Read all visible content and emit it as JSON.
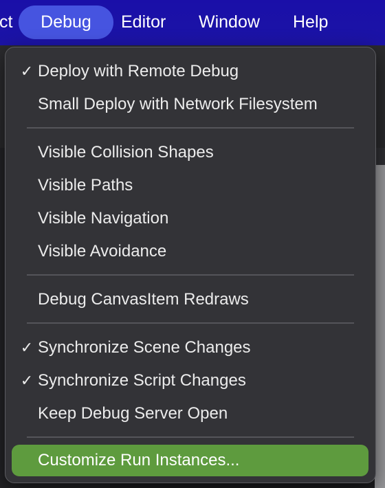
{
  "menubar": {
    "items": [
      {
        "label": "ct"
      },
      {
        "label": "Debug"
      },
      {
        "label": "Editor"
      },
      {
        "label": "Window"
      },
      {
        "label": "Help"
      }
    ]
  },
  "menu": {
    "items": [
      {
        "label": "Deploy with Remote Debug",
        "check": "✓"
      },
      {
        "label": "Small Deploy with Network Filesystem",
        "check": ""
      },
      {
        "label": "Visible Collision Shapes",
        "check": ""
      },
      {
        "label": "Visible Paths",
        "check": ""
      },
      {
        "label": "Visible Navigation",
        "check": ""
      },
      {
        "label": "Visible Avoidance",
        "check": ""
      },
      {
        "label": "Debug CanvasItem Redraws",
        "check": ""
      },
      {
        "label": "Synchronize Scene Changes",
        "check": "✓"
      },
      {
        "label": "Synchronize Script Changes",
        "check": "✓"
      },
      {
        "label": "Keep Debug Server Open",
        "check": ""
      },
      {
        "label": "Customize Run Instances...",
        "check": ""
      }
    ],
    "highlight_color": "#5e9b3e"
  },
  "colors": {
    "menubar_bg": "#1c14a6",
    "menubar_active": "#4654e0"
  }
}
